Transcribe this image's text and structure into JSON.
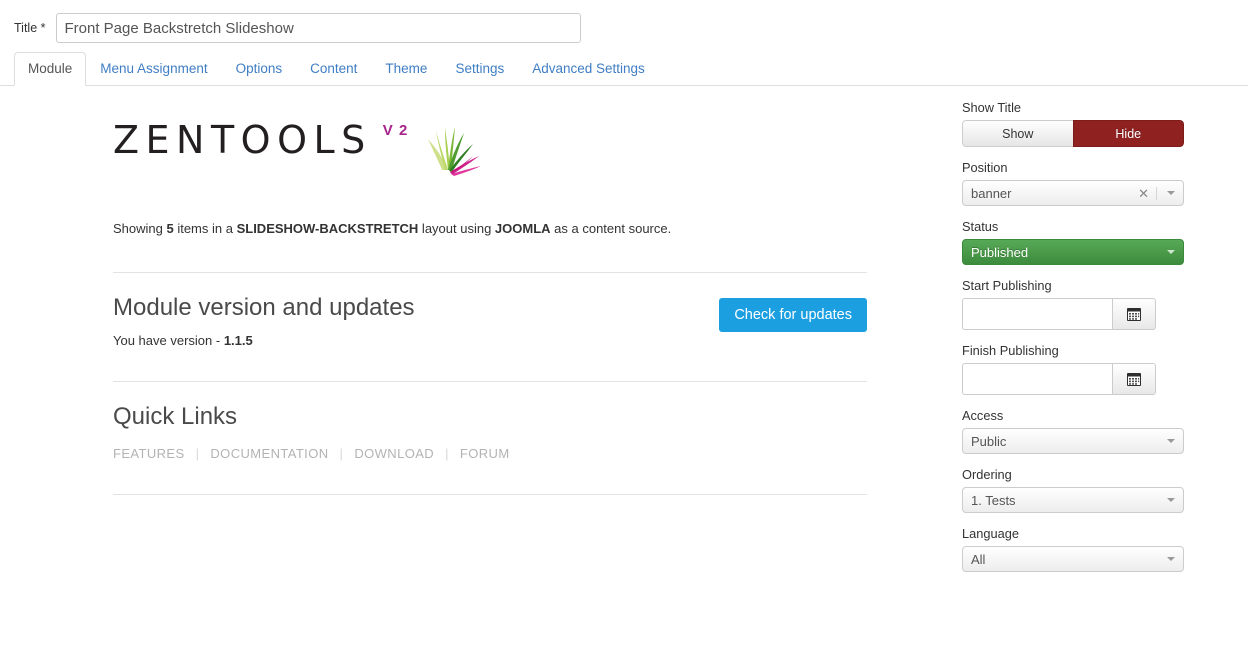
{
  "form": {
    "title_label": "Title *",
    "title_value": "Front Page Backstretch Slideshow"
  },
  "tabs": [
    {
      "label": "Module",
      "active": true
    },
    {
      "label": "Menu Assignment",
      "active": false
    },
    {
      "label": "Options",
      "active": false
    },
    {
      "label": "Content",
      "active": false
    },
    {
      "label": "Theme",
      "active": false
    },
    {
      "label": "Settings",
      "active": false
    },
    {
      "label": "Advanced Settings",
      "active": false
    }
  ],
  "zentools": {
    "logo_word": "ZENTOOLS",
    "logo_version": "V 2",
    "logo_icon": "leaf-fan-icon",
    "showing": {
      "prefix": "Showing ",
      "item_count": "5",
      "mid1": " items in a ",
      "layout": "SLIDESHOW-BACKSTRETCH",
      "mid2": " layout using ",
      "source": "JOOMLA",
      "suffix": " as a content source."
    },
    "version_section": {
      "title": "Module version and updates",
      "version_prefix": "You have version - ",
      "version_number": "1.1.5",
      "update_button": "Check for updates"
    },
    "quick_links": {
      "title": "Quick Links",
      "separator": "|",
      "links": [
        "FEATURES",
        "DOCUMENTATION",
        "DOWNLOAD",
        "FORUM"
      ]
    },
    "colors": {
      "logo_text": "#231f20",
      "logo_v2": "#a6248c",
      "update_button": "#1b9fe0",
      "link_gray": "#b3b3b3"
    }
  },
  "sidebar": {
    "show_title": {
      "label": "Show Title",
      "options": [
        "Show",
        "Hide"
      ],
      "selected": "Hide",
      "active_color": "#8f2120"
    },
    "position": {
      "label": "Position",
      "value": "banner",
      "clear_icon": "✕",
      "chevron_icon": "chevron-down-icon"
    },
    "status": {
      "label": "Status",
      "value": "Published",
      "color": "#3d8b3d"
    },
    "start_publishing": {
      "label": "Start Publishing",
      "value": "",
      "placeholder": "",
      "calendar_icon": "calendar-icon"
    },
    "finish_publishing": {
      "label": "Finish Publishing",
      "value": "",
      "placeholder": "",
      "calendar_icon": "calendar-icon"
    },
    "access": {
      "label": "Access",
      "value": "Public"
    },
    "ordering": {
      "label": "Ordering",
      "value": "1. Tests"
    },
    "language": {
      "label": "Language",
      "value": "All"
    }
  }
}
